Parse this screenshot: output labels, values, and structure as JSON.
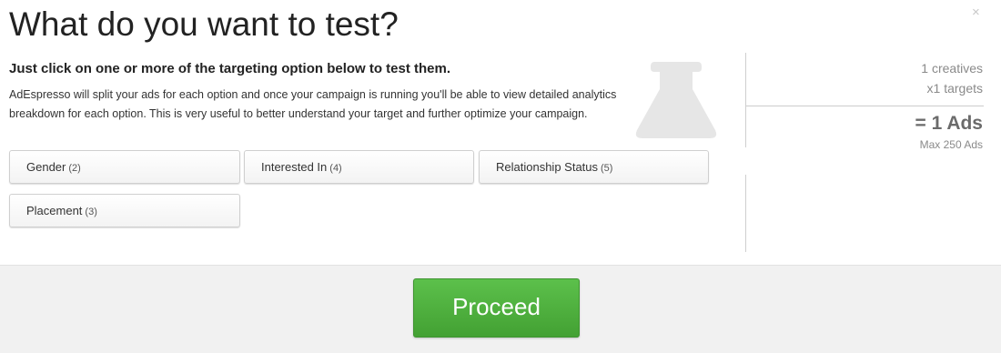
{
  "modal": {
    "title": "What do you want to test?",
    "close_label": "×",
    "subtitle": "Just click on one or more of the targeting option below to test them.",
    "description": "AdEspresso will split your ads for each option and once your campaign is running you'll be able to view detailed analytics breakdown for each option. This is very useful to better understand your target and further optimize your campaign.",
    "decor_icon": "flask-icon"
  },
  "options": [
    {
      "label": "Gender",
      "count": "(2)"
    },
    {
      "label": "Interested In",
      "count": "(4)"
    },
    {
      "label": "Relationship Status",
      "count": "(5)"
    },
    {
      "label": "Placement",
      "count": "(3)"
    }
  ],
  "summary": {
    "creatives": "1 creatives",
    "targets": "x1 targets",
    "ads": "= 1 Ads",
    "max": "Max 250 Ads"
  },
  "footer": {
    "proceed_label": "Proceed"
  },
  "colors": {
    "proceed_green": "#4cae3c",
    "flask_gray": "#e6e6e6",
    "footer_bg": "#f1f1f1"
  }
}
